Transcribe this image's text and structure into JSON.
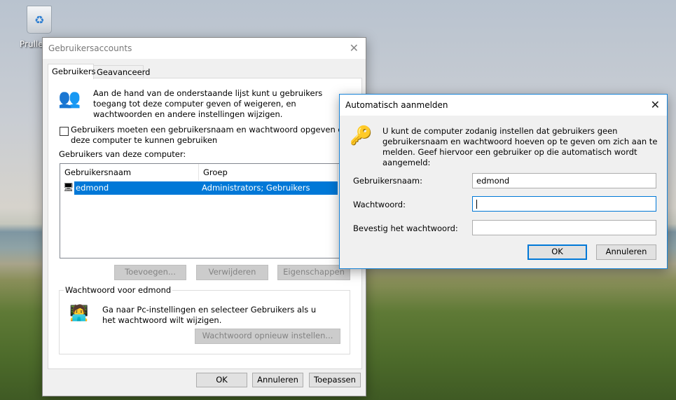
{
  "desktop": {
    "recycle_bin_label": "Prullenbak"
  },
  "main_dialog": {
    "title": "Gebruikersaccounts",
    "tabs": [
      {
        "label": "Gebruikers"
      },
      {
        "label": "Geavanceerd"
      }
    ],
    "intro": "Aan de hand van de onderstaande lijst kunt u gebruikers toegang tot deze computer geven of weigeren, en wachtwoorden en andere instellingen wijzigen.",
    "checkbox_label": "Gebruikers moeten een gebruikersnaam en wachtwoord opgeven om deze computer te kunnen gebruiken",
    "checkbox_checked": false,
    "list_label": "Gebruikers van deze computer:",
    "columns": [
      "Gebruikersnaam",
      "Groep"
    ],
    "rows": [
      {
        "name": "edmond",
        "group": "Administrators; Gebruikers",
        "selected": true
      }
    ],
    "buttons": {
      "add": "Toevoegen...",
      "remove": "Verwijderen",
      "properties": "Eigenschappen"
    },
    "password_group": {
      "title": "Wachtwoord voor edmond",
      "text": "Ga naar Pc-instellingen en selecteer Gebruikers als u het wachtwoord wilt wijzigen.",
      "reset": "Wachtwoord opnieuw instellen..."
    },
    "footer": {
      "ok": "OK",
      "cancel": "Annuleren",
      "apply": "Toepassen"
    }
  },
  "auto_dialog": {
    "title": "Automatisch aanmelden",
    "text": "U kunt de computer zodanig instellen dat gebruikers geen gebruikersnaam en wachtwoord hoeven op te geven om zich aan te melden. Geef hiervoor een gebruiker op die automatisch wordt aangemeld:",
    "fields": {
      "username_label": "Gebruikersnaam:",
      "username_value": "edmond",
      "password_label": "Wachtwoord:",
      "password_value": "",
      "confirm_label": "Bevestig het wachtwoord:",
      "confirm_value": ""
    },
    "ok": "OK",
    "cancel": "Annuleren"
  },
  "colors": {
    "selection": "#0078d7",
    "focus_border": "#0078d7"
  }
}
